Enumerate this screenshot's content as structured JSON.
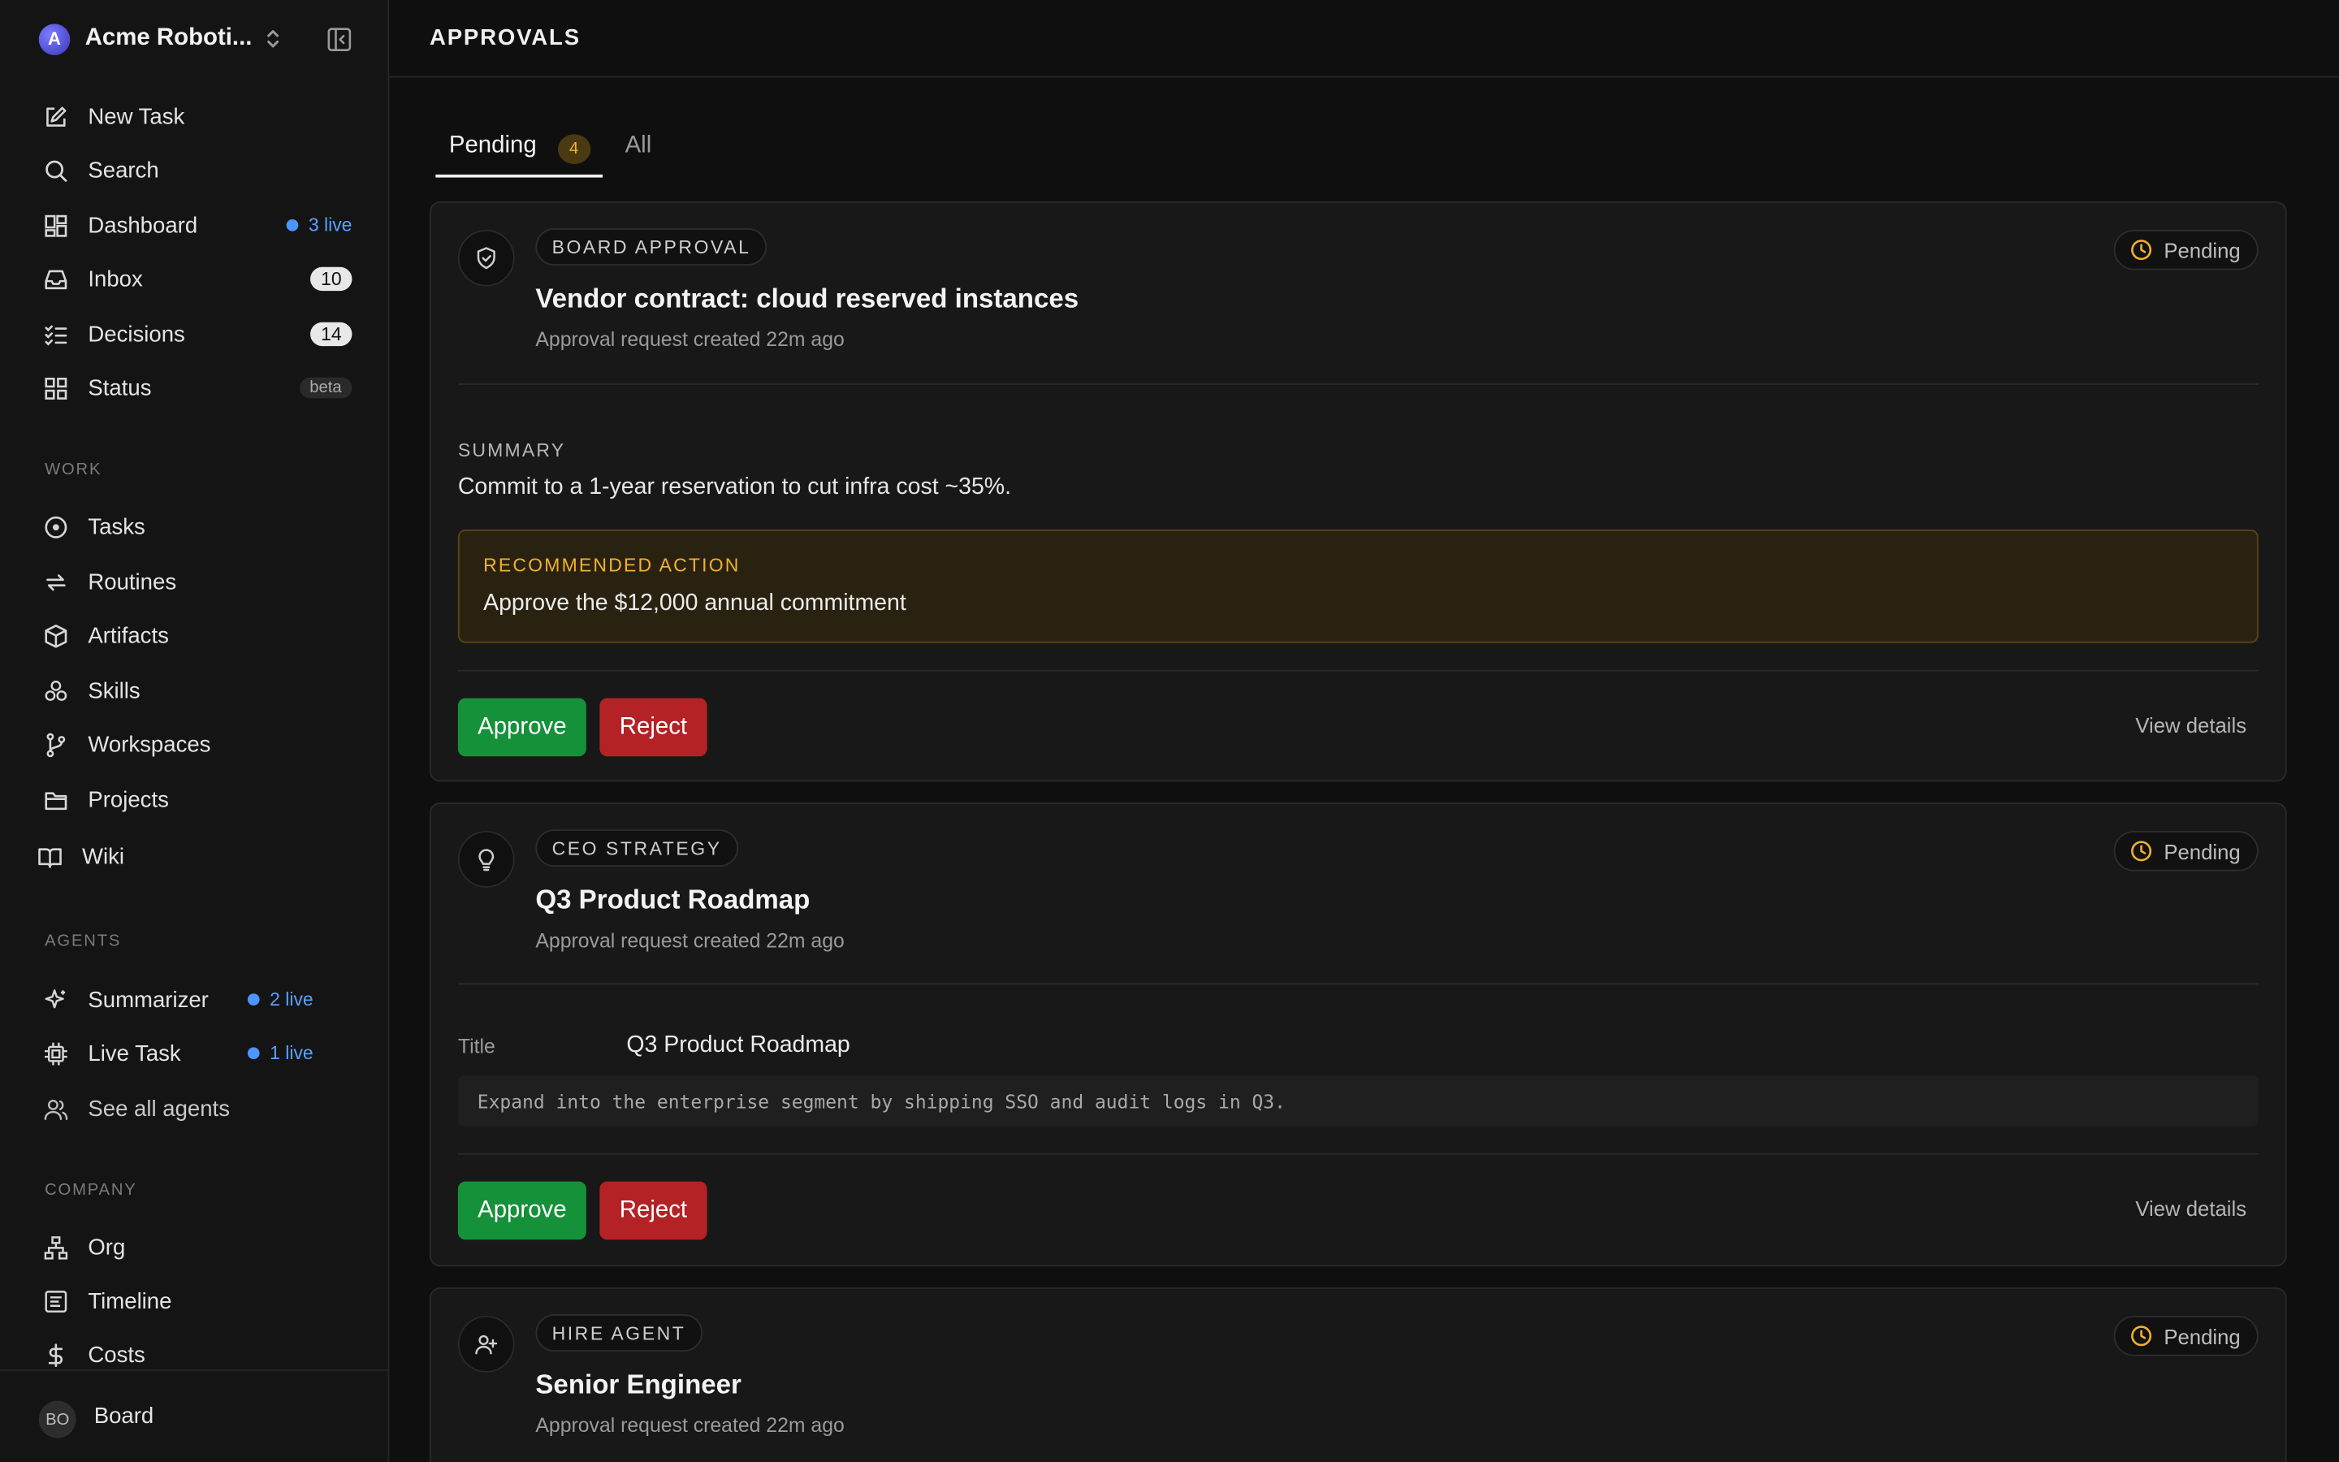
{
  "workspace": {
    "initial": "A",
    "name": "Acme Roboti..."
  },
  "nav": {
    "new_task": "New Task",
    "search": "Search",
    "dashboard": "Dashboard",
    "dashboard_live": "3 live",
    "inbox": "Inbox",
    "inbox_count": "10",
    "decisions": "Decisions",
    "decisions_count": "14",
    "status": "Status",
    "status_badge": "beta"
  },
  "sections": {
    "work": "WORK",
    "agents": "AGENTS",
    "company": "COMPANY"
  },
  "work_items": [
    "Tasks",
    "Routines",
    "Artifacts",
    "Skills",
    "Workspaces",
    "Projects",
    "Wiki"
  ],
  "agents": {
    "summarizer": "Summarizer",
    "summarizer_live": "2 live",
    "live_task": "Live Task",
    "live_task_live": "1 live",
    "see_all": "See all agents"
  },
  "company_items": [
    "Org",
    "Timeline",
    "Costs"
  ],
  "footer": {
    "initials": "BO",
    "name": "Board"
  },
  "header": {
    "title": "APPROVALS"
  },
  "tabs": {
    "pending": "Pending",
    "pending_count": "4",
    "all": "All"
  },
  "cards": [
    {
      "category": "BOARD APPROVAL",
      "title": "Vendor contract: cloud reserved instances",
      "subtitle": "Approval request created 22m ago",
      "status": "Pending",
      "summary_label": "SUMMARY",
      "summary": "Commit to a 1-year reservation to cut infra cost ~35%.",
      "rec_label": "RECOMMENDED ACTION",
      "rec_text": "Approve the $12,000 annual commitment",
      "approve": "Approve",
      "reject": "Reject",
      "view": "View details"
    },
    {
      "category": "CEO STRATEGY",
      "title": "Q3 Product Roadmap",
      "subtitle": "Approval request created 22m ago",
      "status": "Pending",
      "kv_key": "Title",
      "kv_val": "Q3 Product Roadmap",
      "code": "Expand into the enterprise segment by shipping SSO and audit logs in Q3.",
      "approve": "Approve",
      "reject": "Reject",
      "view": "View details"
    },
    {
      "category": "HIRE AGENT",
      "title": "Senior Engineer",
      "subtitle": "Approval request created 22m ago",
      "status": "Pending"
    }
  ],
  "colors": {
    "accent_live": "#4b95ff",
    "approve": "#15913a",
    "reject": "#b42226",
    "pending": "#f1b12c"
  }
}
